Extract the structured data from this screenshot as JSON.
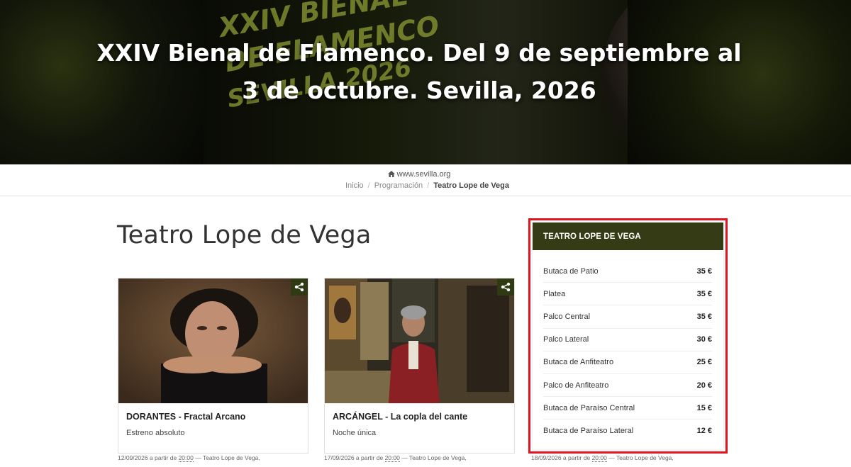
{
  "hero": {
    "title_line1": "XXIV Bienal de Flamenco. Del 9 de septiembre al",
    "title_line2": "3 de octubre. Sevilla, 2026",
    "deco_1": "XXIV BIENAL",
    "deco_2": "DE FLAMENCO",
    "deco_3": "SEVILLA 2026"
  },
  "breadcrumb": {
    "site": "www.sevilla.org",
    "items": [
      "Inicio",
      "Programación"
    ],
    "current": "Teatro Lope de Vega"
  },
  "page": {
    "title": "Teatro Lope de Vega"
  },
  "cards": [
    {
      "title": "DORANTES - Fractal Arcano",
      "subtitle": "Estreno absoluto",
      "date": "12/09/2026",
      "meta_prefix": "a partir de",
      "time": "20:00",
      "venue": "— Teatro Lope de Vega,"
    },
    {
      "title": "ARCÁNGEL - La copla del cante",
      "subtitle": "Noche única",
      "date": "17/09/2026",
      "meta_prefix": "a partir de",
      "time": "20:00",
      "venue": "— Teatro Lope de Vega,"
    },
    {
      "date": "18/09/2026",
      "meta_prefix": "a partir de",
      "time": "20:00",
      "venue": "— Teatro Lope de Vega,"
    }
  ],
  "prices": {
    "header": "TEATRO LOPE DE VEGA",
    "rows": [
      {
        "label": "Butaca de Patio",
        "price": "35 €"
      },
      {
        "label": "Platea",
        "price": "35 €"
      },
      {
        "label": "Palco Central",
        "price": "35 €"
      },
      {
        "label": "Palco Lateral",
        "price": "30 €"
      },
      {
        "label": "Butaca de Anfiteatro",
        "price": "25 €"
      },
      {
        "label": "Palco de Anfiteatro",
        "price": "20 €"
      },
      {
        "label": "Butaca de Paraíso Central",
        "price": "15 €"
      },
      {
        "label": "Butaca de Paraíso Lateral",
        "price": "12 €"
      }
    ]
  },
  "colors": {
    "accent_dark_olive": "#353b14",
    "highlight_red": "#e0151f"
  },
  "icons": {
    "home": "home-icon",
    "share": "share-icon"
  }
}
